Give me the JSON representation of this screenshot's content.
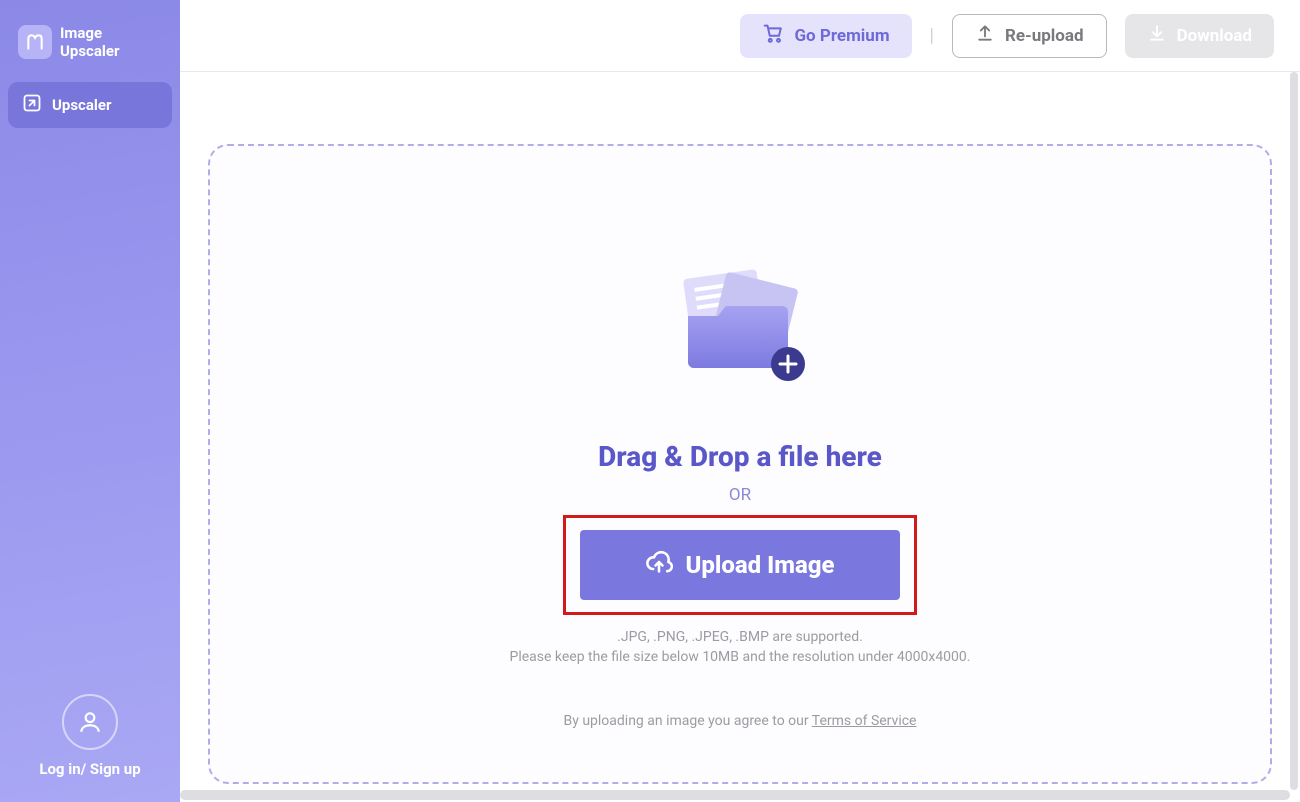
{
  "brand": {
    "line1": "Image",
    "line2": "Upscaler"
  },
  "sidebar": {
    "nav_label": "Upscaler",
    "login_label": "Log in/ Sign up"
  },
  "topbar": {
    "premium_label": "Go Premium",
    "reupload_label": "Re-upload",
    "download_label": "Download"
  },
  "dropzone": {
    "title": "Drag & Drop a file here",
    "or": "OR",
    "upload_label": "Upload Image",
    "supported": ".JPG, .PNG, .JPEG, .BMP are supported.",
    "limits": "Please keep the file size below 10MB and the resolution under 4000x4000.",
    "agree_prefix": "By uploading an image you agree to our ",
    "tos": "Terms of Service"
  }
}
